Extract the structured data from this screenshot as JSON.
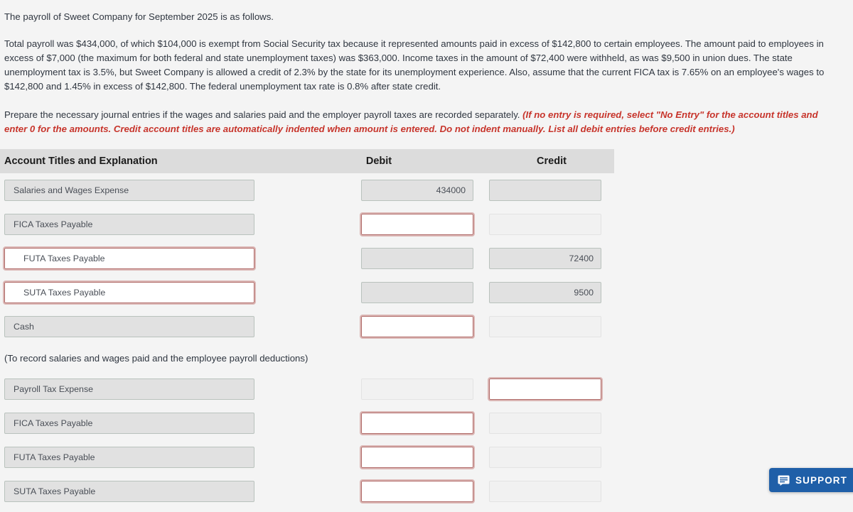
{
  "problem": {
    "line1": "The payroll of Sweet Company for September 2025 is as follows.",
    "line2": "Total payroll was $434,000, of which $104,000 is exempt from Social Security tax because it represented amounts paid in excess of $142,800 to certain employees. The amount paid to employees in excess of $7,000 (the maximum for both federal and state unemployment taxes) was $363,000. Income taxes in the amount of $72,400 were withheld, as was $9,500 in union dues. The state unemployment tax is 3.5%, but Sweet Company is allowed a credit of 2.3% by the state for its unemployment experience. Also, assume that the current FICA tax is 7.65% on an employee's wages to $142,800 and 1.45% in excess of $142,800. The federal unemployment tax rate is 0.8% after state credit.",
    "instruction_plain": "Prepare the necessary journal entries if the wages and salaries paid and the employer payroll taxes are recorded separately. ",
    "instruction_red": "(If no entry is required, select \"No Entry\" for the account titles and enter 0 for the amounts. Credit account titles are automatically indented when amount is entered. Do not indent manually. List all debit entries before credit entries.)"
  },
  "table": {
    "headers": {
      "account": "Account Titles and Explanation",
      "debit": "Debit",
      "credit": "Credit"
    },
    "rows": [
      {
        "account": "Salaries and Wages Expense",
        "account_indent": false,
        "account_error": false,
        "debit": "434000",
        "debit_error": false,
        "debit_pale": false,
        "credit": "",
        "credit_error": false,
        "credit_pale": false
      },
      {
        "account": "FICA Taxes Payable",
        "account_indent": false,
        "account_error": false,
        "debit": "",
        "debit_error": true,
        "debit_pale": false,
        "credit": "",
        "credit_error": false,
        "credit_pale": true
      },
      {
        "account": "FUTA Taxes Payable",
        "account_indent": true,
        "account_error": true,
        "debit": "",
        "debit_error": false,
        "debit_pale": false,
        "credit": "72400",
        "credit_error": false,
        "credit_pale": false
      },
      {
        "account": "SUTA Taxes Payable",
        "account_indent": true,
        "account_error": true,
        "debit": "",
        "debit_error": false,
        "debit_pale": false,
        "credit": "9500",
        "credit_error": false,
        "credit_pale": false
      },
      {
        "account": "Cash",
        "account_indent": false,
        "account_error": false,
        "debit": "",
        "debit_error": true,
        "debit_pale": false,
        "credit": "",
        "credit_error": false,
        "credit_pale": true
      }
    ],
    "memo": "(To record salaries and wages paid and the employee payroll deductions)",
    "rows2": [
      {
        "account": "Payroll Tax Expense",
        "account_indent": false,
        "account_error": false,
        "debit": "",
        "debit_error": false,
        "debit_pale": true,
        "credit": "",
        "credit_error": true,
        "credit_pale": false
      },
      {
        "account": "FICA Taxes Payable",
        "account_indent": false,
        "account_error": false,
        "debit": "",
        "debit_error": true,
        "debit_pale": false,
        "credit": "",
        "credit_error": false,
        "credit_pale": true
      },
      {
        "account": "FUTA Taxes Payable",
        "account_indent": false,
        "account_error": false,
        "debit": "",
        "debit_error": true,
        "debit_pale": false,
        "credit": "",
        "credit_error": false,
        "credit_pale": true
      },
      {
        "account": "SUTA Taxes Payable",
        "account_indent": false,
        "account_error": false,
        "debit": "",
        "debit_error": true,
        "debit_pale": false,
        "credit": "",
        "credit_error": false,
        "credit_pale": true
      }
    ]
  },
  "support": {
    "label": "SUPPORT",
    "icon": "chat-bubble-icon",
    "color": "#1f5fa8"
  }
}
